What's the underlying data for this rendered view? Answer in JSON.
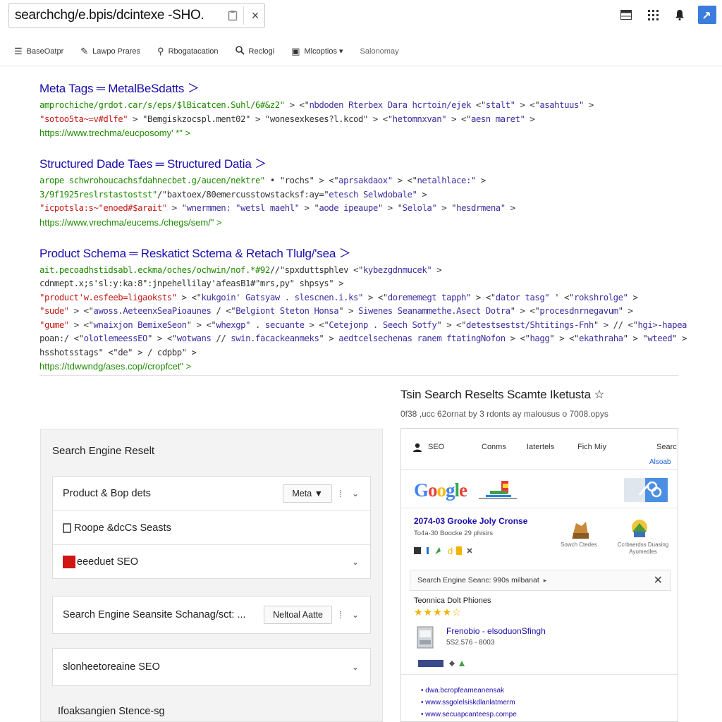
{
  "topbar": {
    "query": "searchchg/e.bpis/dcintexe -SHO.",
    "close_glyph": "×",
    "icons": [
      "table-icon",
      "grid-icon",
      "bell-icon",
      "account-icon"
    ]
  },
  "toolbar": {
    "items": [
      {
        "icon": "list-icon",
        "label": "BaseOatpr"
      },
      {
        "icon": "edit-icon",
        "label": "Lawpo Prares"
      },
      {
        "icon": "magnify-icon",
        "label": "Rbogatacation"
      },
      {
        "icon": "search-icon",
        "label": "Reclogi"
      },
      {
        "icon": "image-icon",
        "label": "Mlcoptios ▾"
      },
      {
        "icon": "",
        "label": "Salonomay"
      }
    ]
  },
  "results": [
    {
      "title": "Meta Tags ═ MetalBeSdatts ＞",
      "lines": [
        [
          {
            "c": "green",
            "t": "amprochiche/grdot.car/s/eps/$lBicatcen.Suhl/6#&z2\""
          },
          {
            "c": "dark",
            "t": " > <\""
          },
          {
            "c": "purple",
            "t": "nbdoden Rterbex Dara hcrtoin/ejek"
          },
          {
            "c": "dark",
            "t": " <\""
          },
          {
            "c": "purple",
            "t": "stalt\""
          },
          {
            "c": "dark",
            "t": " > <\""
          },
          {
            "c": "purple",
            "t": "asahtuus\""
          },
          {
            "c": "dark",
            "t": " >"
          }
        ],
        [
          {
            "c": "red",
            "t": "\"sotoo5ta~=v#dlfe\""
          },
          {
            "c": "dark",
            "t": " > \"Bemgiskzocspl.ment02\" > \"wonesexkeses?l.kcod\" > <\""
          },
          {
            "c": "purple",
            "t": "hetomnxvan\""
          },
          {
            "c": "dark",
            "t": " > <\""
          },
          {
            "c": "purple",
            "t": "aesn maret\""
          },
          {
            "c": "dark",
            "t": " >"
          }
        ]
      ],
      "url": "https://www.trechma/eucposomy' *\" >"
    },
    {
      "title": "Structured Dade Taes ═ Structured Datia ＞",
      "lines": [
        [
          {
            "c": "green",
            "t": "arope schwrohoucachsfdahnecbet.g/aucen/nektre\""
          },
          {
            "c": "dark",
            "t": " • \"rochs\" > <\""
          },
          {
            "c": "purple",
            "t": "aprsakdaox\""
          },
          {
            "c": "dark",
            "t": " > <\""
          },
          {
            "c": "purple",
            "t": "netalhlace:\""
          },
          {
            "c": "dark",
            "t": " >"
          }
        ],
        [
          {
            "c": "green",
            "t": "3/9f1925reslrstastostst\""
          },
          {
            "c": "dark",
            "t": "/\"baxtoex/80emercusstowstacksf:ay=\""
          },
          {
            "c": "purple",
            "t": "etesch Selwdobale\""
          },
          {
            "c": "dark",
            "t": " >"
          }
        ],
        [
          {
            "c": "red",
            "t": "\"icpotsla:s~\"enoed#$arait\""
          },
          {
            "c": "dark",
            "t": " > \""
          },
          {
            "c": "purple",
            "t": "wnermmen: \"wetsl maehl\""
          },
          {
            "c": "dark",
            "t": " > \""
          },
          {
            "c": "purple",
            "t": "aode ipeaupe\""
          },
          {
            "c": "dark",
            "t": " > \""
          },
          {
            "c": "purple",
            "t": "Selola\""
          },
          {
            "c": "dark",
            "t": " > \""
          },
          {
            "c": "purple",
            "t": "hesdrmena\""
          },
          {
            "c": "dark",
            "t": " >"
          }
        ]
      ],
      "url": "https://www.vrechma/eucems./chegs/sem/\" >"
    },
    {
      "title": "Product Schema ═ Reskatict Sctema & Retach Tlulg/'sea ＞",
      "lines": [
        [
          {
            "c": "green",
            "t": "ait.pecoadhstidsabl.eckma/oches/ochwin/nof.*#92"
          },
          {
            "c": "dark",
            "t": "//\"spxduttsphlev <\""
          },
          {
            "c": "purple",
            "t": "kybezgdnmucek\""
          },
          {
            "c": "dark",
            "t": " >"
          }
        ],
        [
          {
            "c": "dark",
            "t": "cdnmept.x;s'sl:y:ka:8\":jnpehellilay'afeasB1#\"mrs,py\" shpsys\""
          },
          {
            "c": "dark",
            "t": " >"
          }
        ],
        [
          {
            "c": "red",
            "t": "\"product'w.esfeeb=ligaoksts\""
          },
          {
            "c": "dark",
            "t": " > <\""
          },
          {
            "c": "purple",
            "t": "kukgoin' Gatsyaw . slescnen.i.ks\""
          },
          {
            "c": "dark",
            "t": " > <\""
          },
          {
            "c": "purple",
            "t": "dorememegt tapph\""
          },
          {
            "c": "dark",
            "t": " > <\""
          },
          {
            "c": "purple",
            "t": "dator tasg\""
          },
          {
            "c": "dark",
            "t": " ' <\""
          },
          {
            "c": "purple",
            "t": "rokshrolge\""
          },
          {
            "c": "dark",
            "t": " > "
          }
        ],
        [
          {
            "c": "red",
            "t": "\"sude\""
          },
          {
            "c": "dark",
            "t": " > <\""
          },
          {
            "c": "purple",
            "t": "awoss.AeteenxSeaPioaunes"
          },
          {
            "c": "dark",
            "t": " / <\""
          },
          {
            "c": "purple",
            "t": "Belgiont Steton Honsa"
          },
          {
            "c": "dark",
            "t": "\" > "
          },
          {
            "c": "purple",
            "t": "Siwenes Seanammethe.Asect Dotra"
          },
          {
            "c": "dark",
            "t": "\" > <\""
          },
          {
            "c": "purple",
            "t": "procesdnrnegavum"
          },
          {
            "c": "dark",
            "t": "\" >"
          }
        ],
        [
          {
            "c": "red",
            "t": "\"gume\""
          },
          {
            "c": "dark",
            "t": " > <\""
          },
          {
            "c": "purple",
            "t": "wnaixjon BemixeSeon"
          },
          {
            "c": "dark",
            "t": "\" > <\""
          },
          {
            "c": "purple",
            "t": "whexgp\" . secuante"
          },
          {
            "c": "dark",
            "t": " > <\""
          },
          {
            "c": "purple",
            "t": "Cetejonp . Seech Sotfy"
          },
          {
            "c": "dark",
            "t": "\" > <\""
          },
          {
            "c": "purple",
            "t": "detestsestst/Shtitings-Fnh"
          },
          {
            "c": "dark",
            "t": "\" > // <\""
          },
          {
            "c": "purple",
            "t": "hgi>-hapearak"
          },
          {
            "c": "dark",
            "t": "\" >"
          }
        ],
        [
          {
            "c": "dark",
            "t": "poan:/ <\""
          },
          {
            "c": "purple",
            "t": "olotlemeessEO"
          },
          {
            "c": "dark",
            "t": "\" > <\""
          },
          {
            "c": "purple",
            "t": "wotwans"
          },
          {
            "c": "dark",
            "t": " // "
          },
          {
            "c": "purple",
            "t": "swin.facackeanmeks"
          },
          {
            "c": "dark",
            "t": "\" > "
          },
          {
            "c": "purple",
            "t": "aedtcelsechenas ranem ftatingNofon"
          },
          {
            "c": "dark",
            "t": " > <\""
          },
          {
            "c": "purple",
            "t": "hagg"
          },
          {
            "c": "dark",
            "t": "\" > <\""
          },
          {
            "c": "purple",
            "t": "ekathraha"
          },
          {
            "c": "dark",
            "t": "\" > \""
          },
          {
            "c": "purple",
            "t": "wteed"
          },
          {
            "c": "dark",
            "t": "\" >"
          }
        ],
        [
          {
            "c": "dark",
            "t": "hsshotsstags\" <\"de\" > / cdpbp\" >"
          }
        ]
      ],
      "url": "https://tdwwndg/ases.cop//cropfcet\" >"
    }
  ],
  "left_panel": {
    "title": "Search Engine Reselt",
    "group1": [
      {
        "label": "Product & Bop dets",
        "pill": "Meta ▼",
        "pipe": "⁞",
        "chev": "⌄"
      },
      {
        "label": "Roope &dcCs Seasts",
        "icon": "doc-icon",
        "chev": ""
      },
      {
        "label": "eeeduet SEO",
        "icon": "red-square-icon",
        "chev": "⌄"
      }
    ],
    "group2": [
      {
        "label": "Search Engine Seansite Schanag/sct: ...",
        "pill": "Neltoal Aatte",
        "pipe": "⁞",
        "chev": "⌄"
      }
    ],
    "group3": [
      {
        "label": "slonheetoreaine SEO",
        "chev": "⌄"
      }
    ],
    "footer_item": "Ifoaksangien Stence-sg"
  },
  "right_section": {
    "title": "Tsin Search Reselts Scamte Iketusta ☆",
    "subtitle": "0f38 ,ucc   62ornat by 3 rdonts ay malousus o 7008.opys",
    "card": {
      "tabs": [
        "SEO",
        "Conms",
        "Iatertels",
        "Fich Miy",
        "Searc"
      ],
      "tab_sub": "Alsoab",
      "google": "Google",
      "headline": "2074-03 Grooke Joly Cronse",
      "meta": "To4a-30 Boocke 29 phisirs",
      "thumb_labels": [
        "Sowch Ctedes",
        "Ccrbaerdss Duasing Ayumedles"
      ],
      "search_bar": "Search Engine Seanc: 990s milbanat",
      "section": "Teonnica Dolt Phiones",
      "stars": "★★★★☆",
      "product_title": "Frenobio - elsoduonSfingh",
      "product_price": "5S2.576 - 8003",
      "links": [
        "dwa.bcropfeameanensak",
        "www.ssgolelsiskdlanlatmerm",
        "www.secuapcanteesp.compe"
      ]
    }
  }
}
